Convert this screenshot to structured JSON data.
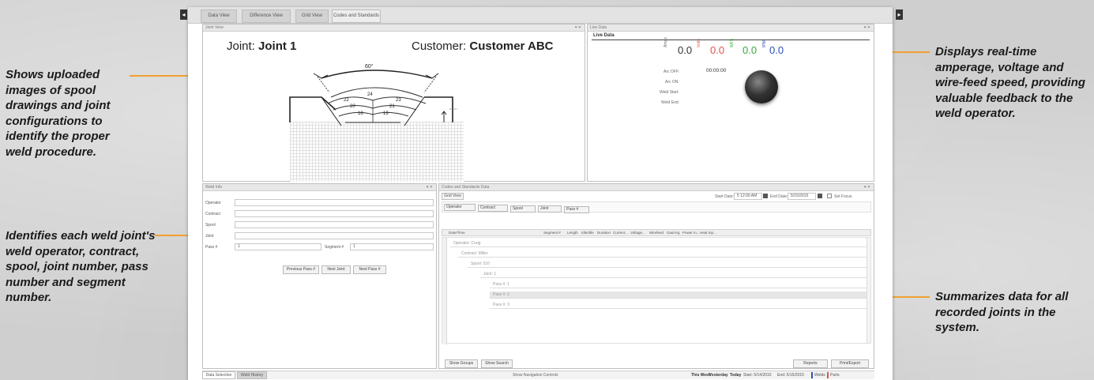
{
  "callouts": {
    "left_top": "Shows uploaded images of spool drawings and joint configurations to identify the proper weld procedure.",
    "left_bottom": "Identifies each weld joint's weld operator, contract, spool, joint number, pass number and segment number.",
    "right_top": "Displays real-time amperage, voltage and wire-feed speed, providing valuable feedback to the weld operator.",
    "right_bottom": "Summarizes data for all recorded joints in the system."
  },
  "tabs": [
    "Data View",
    "Difference View",
    "Grid View",
    "Codes and Standards"
  ],
  "joint_view": {
    "title": "Joint View",
    "joint_label": "Joint:",
    "joint_value": "Joint 1",
    "customer_label": "Customer:",
    "customer_value": "Customer ABC",
    "angle": "60°",
    "passes": [
      "24",
      "22",
      "23",
      "20",
      "21",
      "18",
      "19"
    ]
  },
  "live_data": {
    "panel_title": "Live Data",
    "header": "Live Data",
    "unit_amps": "Amps",
    "unit_volts": "Volts",
    "unit_wfs": "WFS",
    "unit_ipm": "IPM",
    "amps": "0.0",
    "volts": "0.0",
    "wfs": "0.0",
    "extra": "0.0",
    "arc_off_label": "Arc OFF:",
    "arc_off_value": "00:00:00",
    "arc_on_label": "Arc ON:",
    "weld_start_label": "Weld Start:",
    "weld_end_label": "Weld End:",
    "colors": {
      "amps": "#333333",
      "volts": "#d9534f",
      "wfs": "#3aa83a",
      "extra": "#2a4fb5"
    }
  },
  "weld_info": {
    "title": "Weld Info",
    "operator": "Operator",
    "contract": "Contract",
    "spool": "Spool",
    "joint": "Joint",
    "pass_label": "Pass #",
    "pass_value": "1",
    "segment_label": "Segment #",
    "segment_value": "1",
    "buttons": [
      "Previous Pass #",
      "Next Joint",
      "Next Pass #"
    ]
  },
  "codes_data": {
    "title": "Codes and Standards Data",
    "grid_tab": "Grid View",
    "start_label": "Start Date:",
    "start_value": "5 12:00 AM",
    "end_label": "End Date:",
    "end_value": "5/15/2015",
    "set_focus": "Set Focus",
    "filters": [
      "Operator",
      "Contract",
      "Spool",
      "Joint",
      "Pass #"
    ],
    "columns": [
      "Date/Time",
      "Segment #",
      "Length",
      "Idle/Idle",
      "Duration",
      "Current...",
      "Voltage...",
      "Wirefeed",
      "Gas/Arg",
      "Power In...",
      "Heat Inp..."
    ],
    "tree": [
      "Operator: Craig",
      "Contract: Miller",
      "Spool: 510",
      "Joint: 1",
      "Pass #: 1",
      "Pass #: 2",
      "Pass #: 3"
    ],
    "buttons_left": [
      "Show Groups",
      "Show Search"
    ],
    "buttons_right": [
      "Reports",
      "Print/Export"
    ]
  },
  "status_bar": {
    "tabs": [
      "Data Selection",
      "Weld History"
    ],
    "center": "Show Navigation Controls",
    "this_week": "This Week",
    "yesterday": "Yesterday",
    "today": "Today",
    "start": "Start: 5/14/2015",
    "end": "End: 5/15/2015",
    "welds": "Welds",
    "parts": "Parts"
  }
}
